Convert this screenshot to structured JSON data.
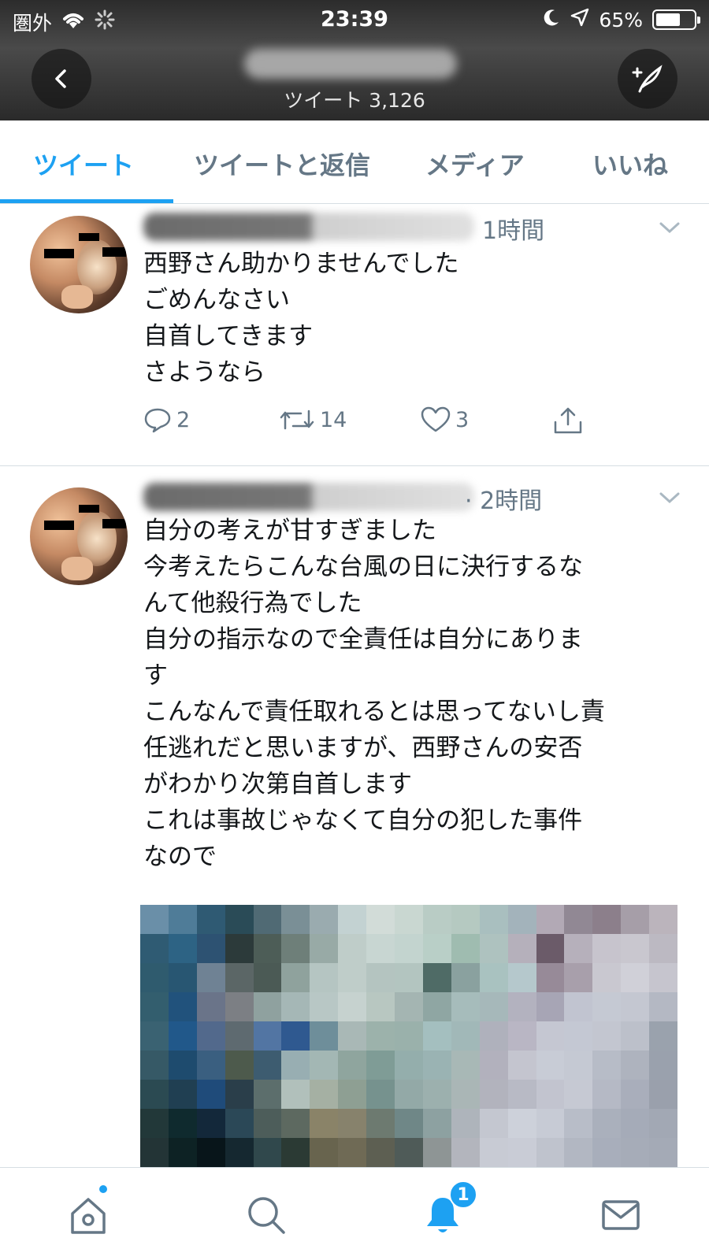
{
  "status_bar": {
    "carrier": "圏外",
    "time": "23:39",
    "battery": "65%",
    "battery_level": 0.65
  },
  "header": {
    "tweet_count": "ツイート 3,126"
  },
  "tabs": [
    {
      "label": "ツイート",
      "active": true
    },
    {
      "label": "ツイートと返信",
      "active": false
    },
    {
      "label": "メディア",
      "active": false
    },
    {
      "label": "いいね",
      "active": false
    }
  ],
  "tweets": [
    {
      "time": "1時間",
      "lines": [
        "西野さん助かりませんでした",
        "ごめんなさい",
        "自首してきます",
        "さようなら"
      ],
      "replies": "2",
      "retweets": "14",
      "likes": "3"
    },
    {
      "time": "· 2時間",
      "lines": [
        "自分の考えが甘すぎました",
        "今考えたらこんな台風の日に決行するな",
        "んて他殺行為でした",
        "自分の指示なので全責任は自分にありま",
        "す",
        "こんなんで責任取れるとは思ってないし責",
        "任逃れだと思いますが、西野さんの安否",
        "がわかり次第自首します",
        "これは事故じゃなくて自分の犯した事件",
        "なので"
      ]
    }
  ],
  "bottom_nav": {
    "items": [
      "home-icon",
      "search-icon",
      "notifications-icon",
      "messages-icon"
    ],
    "notifications_badge": "1"
  },
  "colors": {
    "accent": "#1da1f2",
    "secondary_text": "#657786",
    "border": "#d6dee3"
  }
}
